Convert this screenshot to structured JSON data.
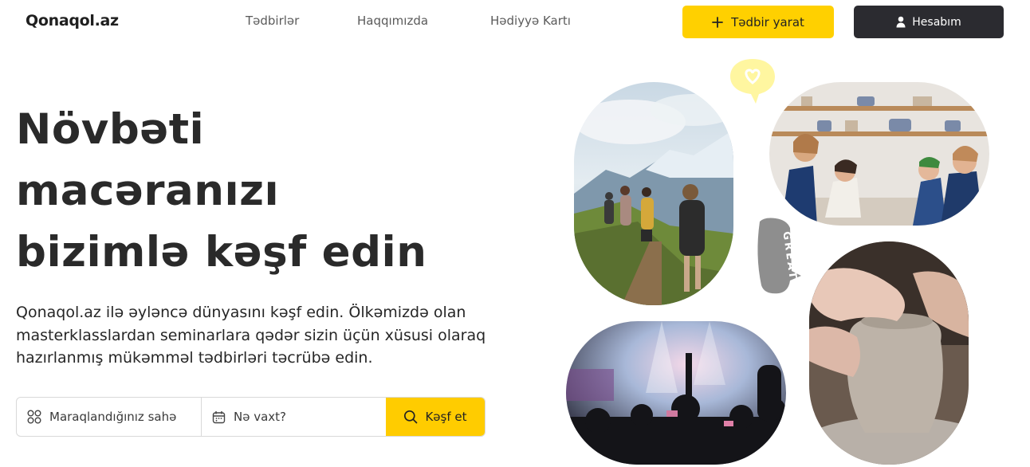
{
  "header": {
    "logo": "Qonaqol.az",
    "nav": [
      "Tədbirlər",
      "Haqqımızda",
      "Hədiyyə Kartı"
    ],
    "create_button": {
      "label": "Tədbir yarat",
      "icon": "plus-icon"
    },
    "account_button": {
      "label": "Hesabım",
      "icon": "user-icon"
    }
  },
  "hero": {
    "title_lines": [
      "Növbəti",
      "macəranızı",
      "bizimlə kəşf edin"
    ],
    "description": "Qonaqol.az ilə əyləncə dünyasını kəşf edin. Ölkəmizdə olan masterklasslardan seminarlara qədər sizin üçün xüsusi olaraq hazırlanmış mükəmməl tədbirləri təcrübə edin."
  },
  "search": {
    "interest_placeholder": "Maraqlandığınız sahə",
    "interest_icon": "grid-icon",
    "date_placeholder": "Nə vaxt?",
    "date_icon": "calendar-icon",
    "submit_label": "Kəşf et",
    "submit_icon": "search-icon"
  },
  "stickers": {
    "great_text": "GREAT"
  },
  "colors": {
    "accent": "#ffd000",
    "dark": "#2b2b30",
    "text": "#2a2a2a"
  }
}
